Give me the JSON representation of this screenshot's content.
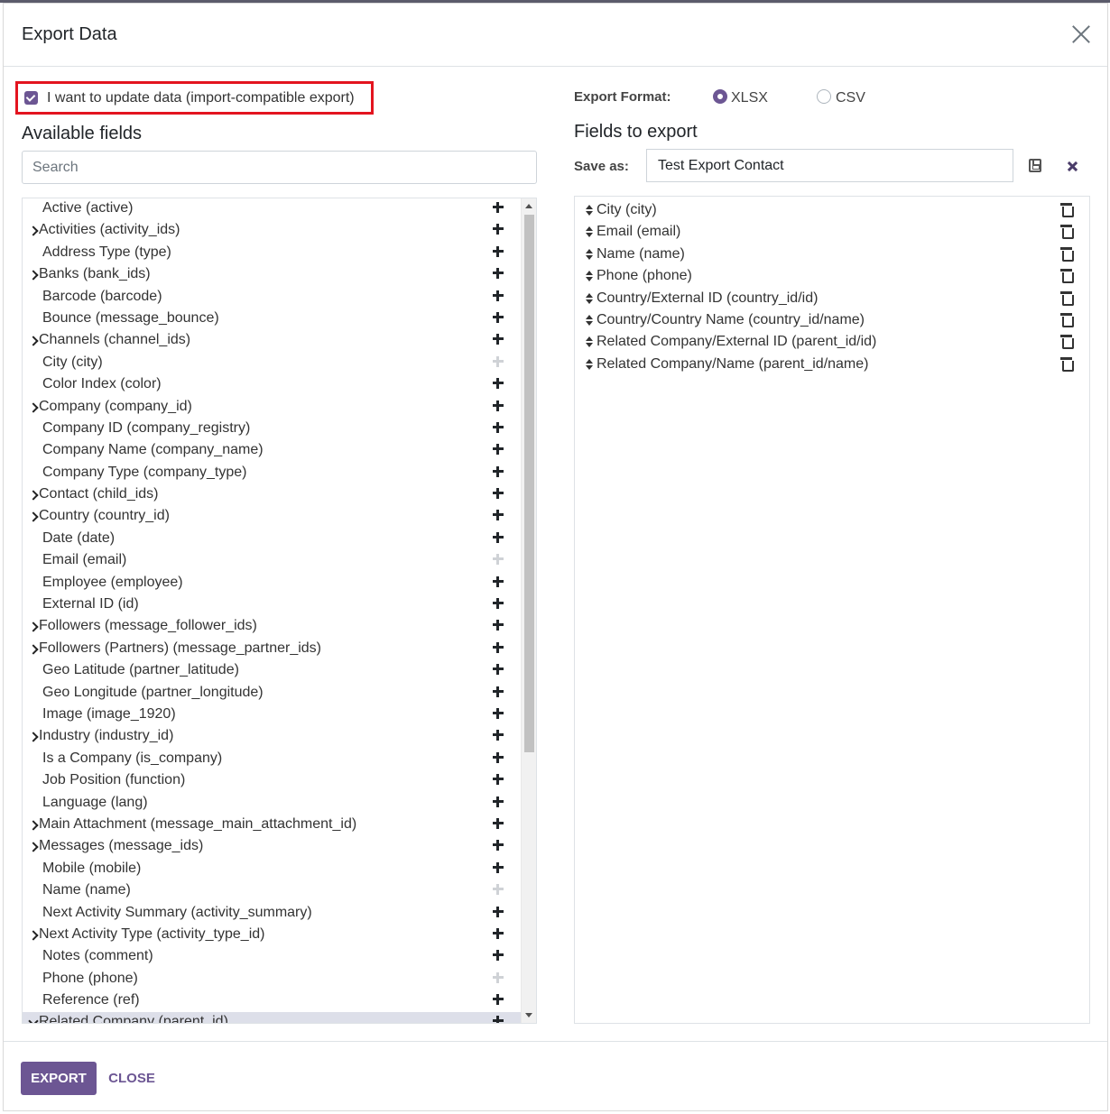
{
  "dialog": {
    "title": "Export Data"
  },
  "options": {
    "import_compatible_label": "I want to update data (import-compatible export)",
    "import_compatible_checked": true,
    "export_format_label": "Export Format:",
    "formats": [
      {
        "label": "XLSX",
        "selected": true
      },
      {
        "label": "CSV",
        "selected": false
      }
    ]
  },
  "available": {
    "heading": "Available fields",
    "search_placeholder": "Search",
    "fields": [
      {
        "label": "Active (active)",
        "expandable": false,
        "added": false
      },
      {
        "label": "Activities (activity_ids)",
        "expandable": true,
        "added": false
      },
      {
        "label": "Address Type (type)",
        "expandable": false,
        "added": false
      },
      {
        "label": "Banks (bank_ids)",
        "expandable": true,
        "added": false
      },
      {
        "label": "Barcode (barcode)",
        "expandable": false,
        "added": false
      },
      {
        "label": "Bounce (message_bounce)",
        "expandable": false,
        "added": false
      },
      {
        "label": "Channels (channel_ids)",
        "expandable": true,
        "added": false
      },
      {
        "label": "City (city)",
        "expandable": false,
        "added": true
      },
      {
        "label": "Color Index (color)",
        "expandable": false,
        "added": false
      },
      {
        "label": "Company (company_id)",
        "expandable": true,
        "added": false
      },
      {
        "label": "Company ID (company_registry)",
        "expandable": false,
        "added": false
      },
      {
        "label": "Company Name (company_name)",
        "expandable": false,
        "added": false
      },
      {
        "label": "Company Type (company_type)",
        "expandable": false,
        "added": false
      },
      {
        "label": "Contact (child_ids)",
        "expandable": true,
        "added": false
      },
      {
        "label": "Country (country_id)",
        "expandable": true,
        "added": false
      },
      {
        "label": "Date (date)",
        "expandable": false,
        "added": false
      },
      {
        "label": "Email (email)",
        "expandable": false,
        "added": true
      },
      {
        "label": "Employee (employee)",
        "expandable": false,
        "added": false
      },
      {
        "label": "External ID (id)",
        "expandable": false,
        "added": false
      },
      {
        "label": "Followers (message_follower_ids)",
        "expandable": true,
        "added": false
      },
      {
        "label": "Followers (Partners) (message_partner_ids)",
        "expandable": true,
        "added": false
      },
      {
        "label": "Geo Latitude (partner_latitude)",
        "expandable": false,
        "added": false
      },
      {
        "label": "Geo Longitude (partner_longitude)",
        "expandable": false,
        "added": false
      },
      {
        "label": "Image (image_1920)",
        "expandable": false,
        "added": false
      },
      {
        "label": "Industry (industry_id)",
        "expandable": true,
        "added": false
      },
      {
        "label": "Is a Company (is_company)",
        "expandable": false,
        "added": false
      },
      {
        "label": "Job Position (function)",
        "expandable": false,
        "added": false
      },
      {
        "label": "Language (lang)",
        "expandable": false,
        "added": false
      },
      {
        "label": "Main Attachment (message_main_attachment_id)",
        "expandable": true,
        "added": false
      },
      {
        "label": "Messages (message_ids)",
        "expandable": true,
        "added": false
      },
      {
        "label": "Mobile (mobile)",
        "expandable": false,
        "added": false
      },
      {
        "label": "Name (name)",
        "expandable": false,
        "added": true
      },
      {
        "label": "Next Activity Summary (activity_summary)",
        "expandable": false,
        "added": false
      },
      {
        "label": "Next Activity Type (activity_type_id)",
        "expandable": true,
        "added": false
      },
      {
        "label": "Notes (comment)",
        "expandable": false,
        "added": false
      },
      {
        "label": "Phone (phone)",
        "expandable": false,
        "added": true
      },
      {
        "label": "Reference (ref)",
        "expandable": false,
        "added": false
      },
      {
        "label": "Related Company (parent_id)",
        "expandable": true,
        "added": false,
        "expanded": true,
        "highlighted": true
      }
    ]
  },
  "export": {
    "heading": "Fields to export",
    "save_as_label": "Save as:",
    "save_as_value": "Test Export Contact",
    "fields": [
      "City (city)",
      "Email (email)",
      "Name (name)",
      "Phone (phone)",
      "Country/External ID (country_id/id)",
      "Country/Country Name (country_id/name)",
      "Related Company/External ID (parent_id/id)",
      "Related Company/Name (parent_id/name)"
    ]
  },
  "footer": {
    "export_label": "EXPORT",
    "close_label": "CLOSE"
  },
  "colors": {
    "accent": "#6c5693",
    "highlight_border": "#e3141f",
    "selected_row": "#dddfe9"
  }
}
